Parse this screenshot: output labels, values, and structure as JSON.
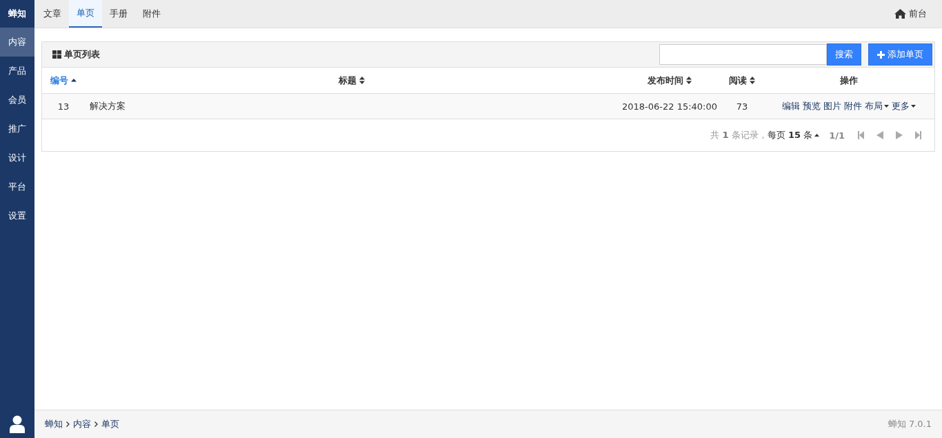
{
  "sidebar": {
    "brand": "蝉知",
    "items": [
      {
        "label": "内容",
        "selected": true
      },
      {
        "label": "产品",
        "selected": false
      },
      {
        "label": "会员",
        "selected": false
      },
      {
        "label": "推广",
        "selected": false
      },
      {
        "label": "设计",
        "selected": false
      },
      {
        "label": "平台",
        "selected": false
      },
      {
        "label": "设置",
        "selected": false
      }
    ]
  },
  "tabs": [
    {
      "label": "文章",
      "selected": false
    },
    {
      "label": "单页",
      "selected": true
    },
    {
      "label": "手册",
      "selected": false
    },
    {
      "label": "附件",
      "selected": false
    }
  ],
  "frontend_link": "前台",
  "panel": {
    "title": "单页列表",
    "search_button": "搜索",
    "add_button": "添加单页",
    "table": {
      "columns": [
        {
          "label": "编号",
          "kind": "ascending"
        },
        {
          "label": "标题",
          "kind": "sortable"
        },
        {
          "label": "发布时间",
          "kind": "sortable"
        },
        {
          "label": "阅读",
          "kind": "sortable"
        },
        {
          "label": "操作",
          "kind": "plain"
        }
      ],
      "rows": [
        {
          "id": "13",
          "title": "解决方案",
          "time": "2018-06-22 15:40:00",
          "views": "73",
          "actions": [
            {
              "label": "编辑",
              "dropdown": false
            },
            {
              "label": "预览",
              "dropdown": false
            },
            {
              "label": "图片",
              "dropdown": false
            },
            {
              "label": "附件",
              "dropdown": false
            },
            {
              "label": "布局",
              "dropdown": true
            },
            {
              "label": "更多",
              "dropdown": true
            }
          ]
        }
      ]
    },
    "pager": {
      "summary": "共 **1** 条记录，",
      "page_size": "每页 **15** 条",
      "page": "1/1",
      "buttons": [
        {
          "kind": "first",
          "disabled": true
        },
        {
          "kind": "prev",
          "disabled": true
        },
        {
          "kind": "next",
          "disabled": true
        },
        {
          "kind": "last",
          "disabled": true
        }
      ]
    }
  },
  "breadcrumb": [
    "蝉知",
    "内容",
    "单页"
  ],
  "version": "蝉知 7.0.1"
}
